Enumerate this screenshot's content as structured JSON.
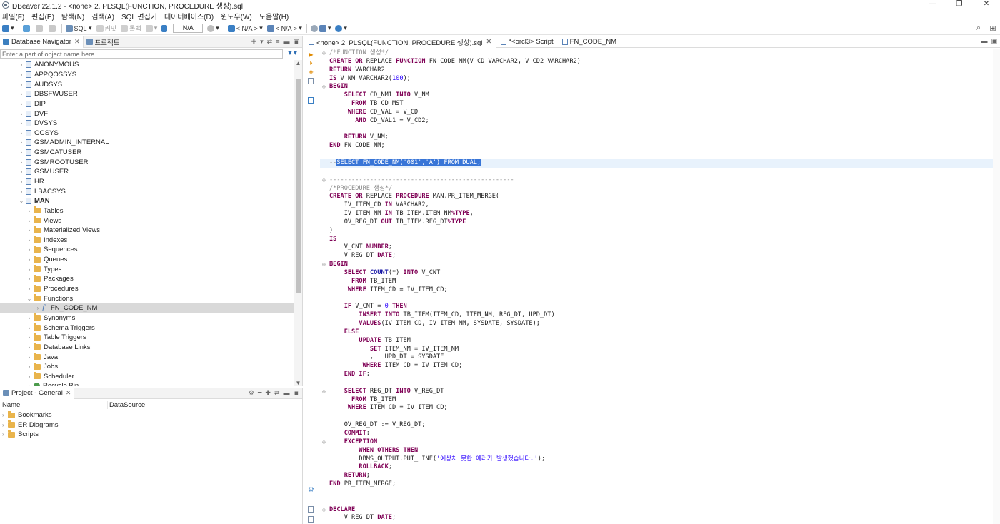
{
  "window": {
    "title": "DBeaver 22.1.2 - <none> 2. PLSQL(FUNCTION, PROCEDURE 생성).sql",
    "controls": [
      "—",
      "❐",
      "✕"
    ]
  },
  "menu": [
    "파일(F)",
    "편집(E)",
    "탐색(N)",
    "검색(A)",
    "SQL 편집기",
    "데이터베이스(D)",
    "윈도우(W)",
    "도움말(H)"
  ],
  "toolbar": {
    "sql_label": "SQL",
    "commit_label": "커밋",
    "rollback_label": "롤백",
    "tx_mode": "N/A",
    "datasource": "< N/A >",
    "schema": "< N/A >"
  },
  "navigator": {
    "tab_label": "Database Navigator",
    "project_tab_label": "프로젝트",
    "filter_placeholder": "Enter a part of object name here",
    "schemas": [
      "ANONYMOUS",
      "APPQOSSYS",
      "AUDSYS",
      "DBSFWUSER",
      "DIP",
      "DVF",
      "DVSYS",
      "GGSYS",
      "GSMADMIN_INTERNAL",
      "GSMCATUSER",
      "GSMROOTUSER",
      "GSMUSER",
      "HR",
      "LBACSYS"
    ],
    "expanded_schema": "MAN",
    "folders_before": [
      "Tables",
      "Views",
      "Materialized Views",
      "Indexes",
      "Sequences",
      "Queues",
      "Types",
      "Packages",
      "Procedures"
    ],
    "functions_folder": "Functions",
    "selected_function": "FN_CODE_NM",
    "folders_after": [
      "Synonyms",
      "Schema Triggers",
      "Table Triggers",
      "Database Links",
      "Java",
      "Jobs",
      "Scheduler"
    ],
    "recycle_bin": "Recycle Bin"
  },
  "project": {
    "tab_label": "Project - General",
    "columns": [
      "Name",
      "DataSource"
    ],
    "items": [
      "Bookmarks",
      "ER Diagrams",
      "Scripts"
    ]
  },
  "editor": {
    "tabs": [
      "<none> 2. PLSQL(FUNCTION, PROCEDURE 생성).sql",
      "*<orcl3> Script",
      "FN_CODE_NM"
    ],
    "lines": [
      {
        "fold": "⊖",
        "parts": [
          [
            "cmt",
            "/*FUNCTION 생성*/"
          ]
        ]
      },
      {
        "parts": [
          [
            "kw",
            "CREATE"
          ],
          [
            "",
            " "
          ],
          [
            "kw",
            "OR"
          ],
          [
            "",
            " REPLACE "
          ],
          [
            "kw",
            "FUNCTION"
          ],
          [
            "",
            " FN_CODE_NM(V_CD VARCHAR2, V_CD2 VARCHAR2)"
          ]
        ]
      },
      {
        "parts": [
          [
            "kw",
            "RETURN"
          ],
          [
            "",
            " VARCHAR2"
          ]
        ]
      },
      {
        "parts": [
          [
            "kw",
            "IS"
          ],
          [
            "",
            " V_NM VARCHAR2("
          ],
          [
            "num",
            "100"
          ],
          [
            "",
            ");"
          ]
        ]
      },
      {
        "fold": "⊖",
        "parts": [
          [
            "kw",
            "BEGIN"
          ]
        ]
      },
      {
        "parts": [
          [
            "",
            "    "
          ],
          [
            "kw",
            "SELECT"
          ],
          [
            "",
            " CD_NM1 "
          ],
          [
            "kw",
            "INTO"
          ],
          [
            "",
            " V_NM"
          ]
        ]
      },
      {
        "parts": [
          [
            "",
            "      "
          ],
          [
            "kw",
            "FROM"
          ],
          [
            "",
            " TB_CD_MST"
          ]
        ]
      },
      {
        "parts": [
          [
            "",
            "     "
          ],
          [
            "kw",
            "WHERE"
          ],
          [
            "",
            " CD_VAL = V_CD"
          ]
        ]
      },
      {
        "parts": [
          [
            "",
            "       "
          ],
          [
            "kw",
            "AND"
          ],
          [
            "",
            " CD_VAL1 = V_CD2;"
          ]
        ]
      },
      {
        "parts": [
          [
            "",
            ""
          ]
        ]
      },
      {
        "parts": [
          [
            "",
            "    "
          ],
          [
            "kw",
            "RETURN"
          ],
          [
            "",
            " V_NM;"
          ]
        ]
      },
      {
        "parts": [
          [
            "kw",
            "END"
          ],
          [
            "",
            " FN_CODE_NM;"
          ]
        ]
      },
      {
        "parts": [
          [
            "",
            ""
          ]
        ]
      },
      {
        "hl": true,
        "parts": [
          [
            "cmt",
            "--"
          ],
          [
            "sel",
            "SELECT FN_CODE_NM('001','A') FROM DUAL;"
          ]
        ]
      },
      {
        "parts": [
          [
            "",
            ""
          ]
        ]
      },
      {
        "fold": "⊖",
        "parts": [
          [
            "cmt",
            "--------------------------------------------------"
          ]
        ]
      },
      {
        "parts": [
          [
            "cmt",
            "/*PROCEDURE 생성*/"
          ]
        ]
      },
      {
        "parts": [
          [
            "kw",
            "CREATE"
          ],
          [
            "",
            " "
          ],
          [
            "kw",
            "OR"
          ],
          [
            "",
            " REPLACE "
          ],
          [
            "kw",
            "PROCEDURE"
          ],
          [
            "",
            " MAN.PR_ITEM_MERGE("
          ]
        ]
      },
      {
        "parts": [
          [
            "",
            "    IV_ITEM_CD "
          ],
          [
            "kw",
            "IN"
          ],
          [
            "",
            " VARCHAR2,"
          ]
        ]
      },
      {
        "parts": [
          [
            "",
            "    IV_ITEM_NM "
          ],
          [
            "kw",
            "IN"
          ],
          [
            "",
            " TB_ITEM.ITEM_NM"
          ],
          [
            "kw",
            "%TYPE"
          ],
          [
            "",
            ","
          ]
        ]
      },
      {
        "parts": [
          [
            "",
            "    OV_REG_DT "
          ],
          [
            "kw",
            "OUT"
          ],
          [
            "",
            " TB_ITEM.REG_DT"
          ],
          [
            "kw",
            "%TYPE"
          ]
        ]
      },
      {
        "parts": [
          [
            "",
            ")"
          ]
        ]
      },
      {
        "parts": [
          [
            "kw",
            "IS"
          ]
        ]
      },
      {
        "parts": [
          [
            "",
            "    V_CNT "
          ],
          [
            "kw",
            "NUMBER"
          ],
          [
            "",
            ";"
          ]
        ]
      },
      {
        "parts": [
          [
            "",
            "    V_REG_DT "
          ],
          [
            "kw",
            "DATE"
          ],
          [
            "",
            ";"
          ]
        ]
      },
      {
        "fold": "⊖",
        "parts": [
          [
            "kw",
            "BEGIN"
          ]
        ]
      },
      {
        "parts": [
          [
            "",
            "    "
          ],
          [
            "kw",
            "SELECT"
          ],
          [
            "",
            " "
          ],
          [
            "fn",
            "COUNT"
          ],
          [
            "",
            "(*) "
          ],
          [
            "kw",
            "INTO"
          ],
          [
            "",
            " V_CNT"
          ]
        ]
      },
      {
        "parts": [
          [
            "",
            "      "
          ],
          [
            "kw",
            "FROM"
          ],
          [
            "",
            " TB_ITEM"
          ]
        ]
      },
      {
        "parts": [
          [
            "",
            "     "
          ],
          [
            "kw",
            "WHERE"
          ],
          [
            "",
            " ITEM_CD = IV_ITEM_CD;"
          ]
        ]
      },
      {
        "parts": [
          [
            "",
            ""
          ]
        ]
      },
      {
        "parts": [
          [
            "",
            "    "
          ],
          [
            "kw",
            "IF"
          ],
          [
            "",
            " V_CNT = "
          ],
          [
            "num",
            "0"
          ],
          [
            "",
            " "
          ],
          [
            "kw",
            "THEN"
          ]
        ]
      },
      {
        "parts": [
          [
            "",
            "        "
          ],
          [
            "kw",
            "INSERT"
          ],
          [
            "",
            " "
          ],
          [
            "kw",
            "INTO"
          ],
          [
            "",
            " TB_ITEM(ITEM_CD, ITEM_NM, REG_DT, UPD_DT)"
          ]
        ]
      },
      {
        "parts": [
          [
            "",
            "        "
          ],
          [
            "kw",
            "VALUES"
          ],
          [
            "",
            "(IV_ITEM_CD, IV_ITEM_NM, SYSDATE, SYSDATE);"
          ]
        ]
      },
      {
        "parts": [
          [
            "",
            "    "
          ],
          [
            "kw",
            "ELSE"
          ]
        ]
      },
      {
        "parts": [
          [
            "",
            "        "
          ],
          [
            "kw",
            "UPDATE"
          ],
          [
            "",
            " TB_ITEM"
          ]
        ]
      },
      {
        "parts": [
          [
            "",
            "           "
          ],
          [
            "kw",
            "SET"
          ],
          [
            "",
            " ITEM_NM = IV_ITEM_NM"
          ]
        ]
      },
      {
        "parts": [
          [
            "",
            "           ,   UPD_DT = SYSDATE"
          ]
        ]
      },
      {
        "parts": [
          [
            "",
            "         "
          ],
          [
            "kw",
            "WHERE"
          ],
          [
            "",
            " ITEM_CD = IV_ITEM_CD;"
          ]
        ]
      },
      {
        "parts": [
          [
            "",
            "    "
          ],
          [
            "kw",
            "END IF"
          ],
          [
            "",
            ";"
          ]
        ]
      },
      {
        "parts": [
          [
            "",
            ""
          ]
        ]
      },
      {
        "fold": "⊖",
        "parts": [
          [
            "",
            "    "
          ],
          [
            "kw",
            "SELECT"
          ],
          [
            "",
            " REG_DT "
          ],
          [
            "kw",
            "INTO"
          ],
          [
            "",
            " V_REG_DT"
          ]
        ]
      },
      {
        "parts": [
          [
            "",
            "      "
          ],
          [
            "kw",
            "FROM"
          ],
          [
            "",
            " TB_ITEM"
          ]
        ]
      },
      {
        "parts": [
          [
            "",
            "     "
          ],
          [
            "kw",
            "WHERE"
          ],
          [
            "",
            " ITEM_CD = IV_ITEM_CD;"
          ]
        ]
      },
      {
        "parts": [
          [
            "",
            ""
          ]
        ]
      },
      {
        "parts": [
          [
            "",
            "    OV_REG_DT := V_REG_DT;"
          ]
        ]
      },
      {
        "parts": [
          [
            "",
            "    "
          ],
          [
            "kw",
            "COMMIT"
          ],
          [
            "",
            ";"
          ]
        ]
      },
      {
        "fold": "⊖",
        "parts": [
          [
            "",
            "    "
          ],
          [
            "kw",
            "EXCEPTION"
          ]
        ]
      },
      {
        "parts": [
          [
            "",
            "        "
          ],
          [
            "kw",
            "WHEN"
          ],
          [
            "",
            " "
          ],
          [
            "kw",
            "OTHERS"
          ],
          [
            "",
            " "
          ],
          [
            "kw",
            "THEN"
          ]
        ]
      },
      {
        "parts": [
          [
            "",
            "        DBMS_OUTPUT.PUT_LINE("
          ],
          [
            "str",
            "'예상치 못한 에러가 발생했습니다.'"
          ],
          [
            "",
            ");"
          ]
        ]
      },
      {
        "parts": [
          [
            "",
            "        "
          ],
          [
            "kw",
            "ROLLBACK"
          ],
          [
            "",
            ";"
          ]
        ]
      },
      {
        "parts": [
          [
            "",
            "    "
          ],
          [
            "kw",
            "RETURN"
          ],
          [
            "",
            ";"
          ]
        ]
      },
      {
        "parts": [
          [
            "kw",
            "END"
          ],
          [
            "",
            " PR_ITEM_MERGE;"
          ]
        ]
      },
      {
        "parts": [
          [
            "",
            ""
          ]
        ]
      },
      {
        "parts": [
          [
            "",
            ""
          ]
        ]
      },
      {
        "fold": "⊖",
        "parts": [
          [
            "kw",
            "DECLARE"
          ]
        ]
      },
      {
        "parts": [
          [
            "",
            "    V_REG_DT "
          ],
          [
            "kw",
            "DATE"
          ],
          [
            "",
            ";"
          ]
        ]
      }
    ]
  }
}
